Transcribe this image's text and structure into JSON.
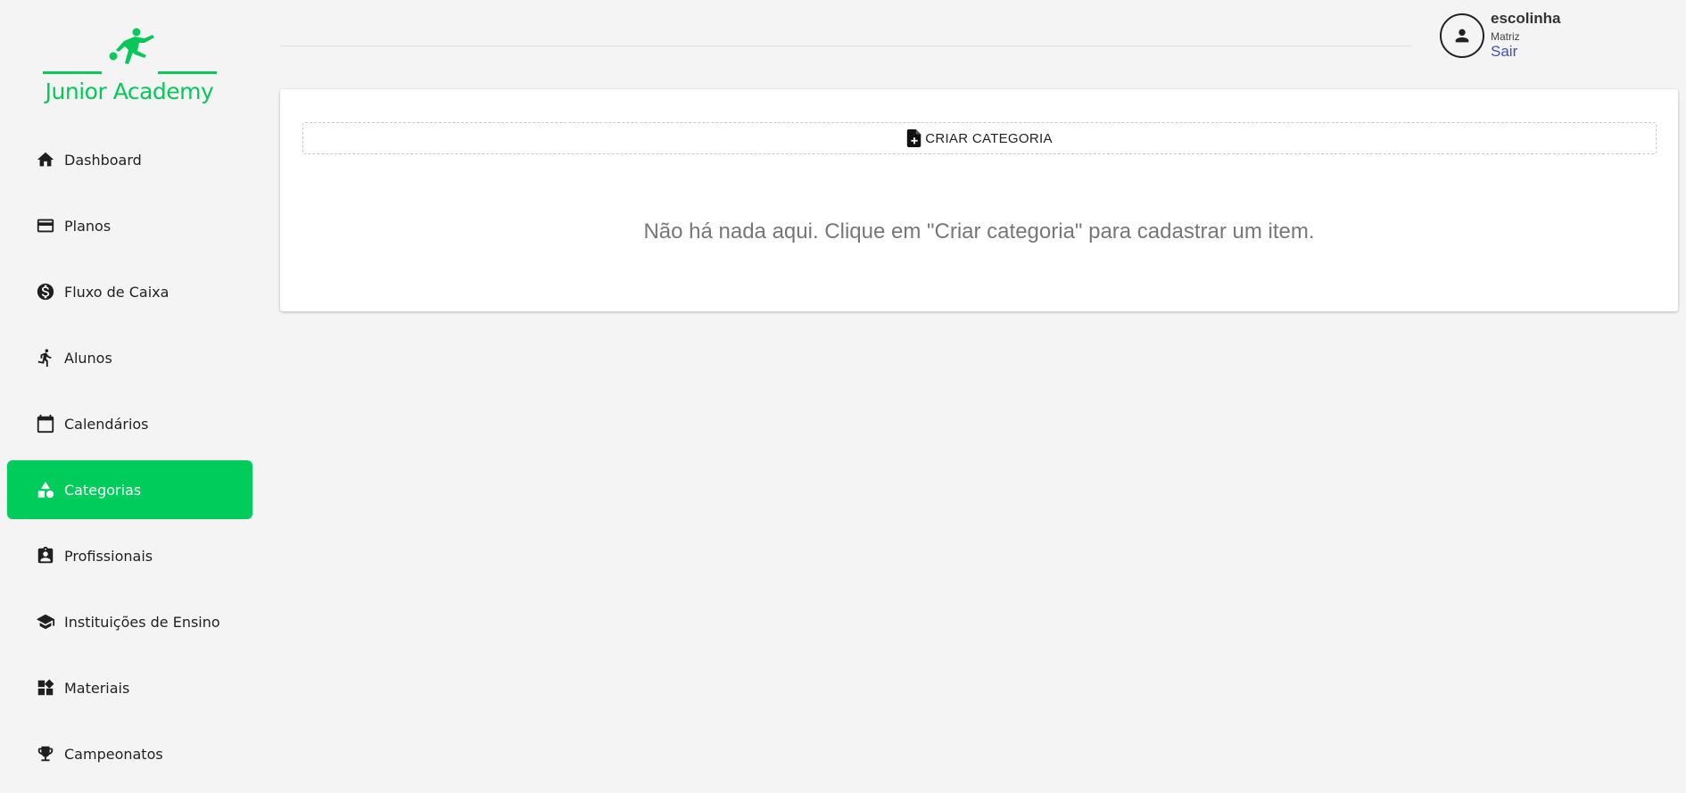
{
  "brand": {
    "name": "Junior Academy",
    "color": "#08c85a"
  },
  "sidebar": {
    "accent": "#00cc5c",
    "items": [
      {
        "label": "Dashboard",
        "icon": "home-icon",
        "active": false
      },
      {
        "label": "Planos",
        "icon": "credit-card-icon",
        "active": false
      },
      {
        "label": "Fluxo de Caixa",
        "icon": "dollar-circle-icon",
        "active": false
      },
      {
        "label": "Alunos",
        "icon": "running-person-icon",
        "active": false
      },
      {
        "label": "Calendários",
        "icon": "calendar-icon",
        "active": false
      },
      {
        "label": "Categorias",
        "icon": "shapes-icon",
        "active": true
      },
      {
        "label": "Profissionais",
        "icon": "badge-icon",
        "active": false
      },
      {
        "label": "Instituições de Ensino",
        "icon": "graduation-cap-icon",
        "active": false
      },
      {
        "label": "Materiais",
        "icon": "widgets-icon",
        "active": false
      },
      {
        "label": "Campeonatos",
        "icon": "trophy-icon",
        "active": false
      }
    ]
  },
  "user": {
    "name": "escolinha",
    "role": "Matriz",
    "logout_label": "Sair",
    "icon": "person-icon"
  },
  "main": {
    "create_button_label": "CRIAR CATEGORIA",
    "create_button_icon": "file-plus-icon",
    "empty_message": "Não há nada aqui. Clique em \"Criar categoria\" para cadastrar um item."
  }
}
